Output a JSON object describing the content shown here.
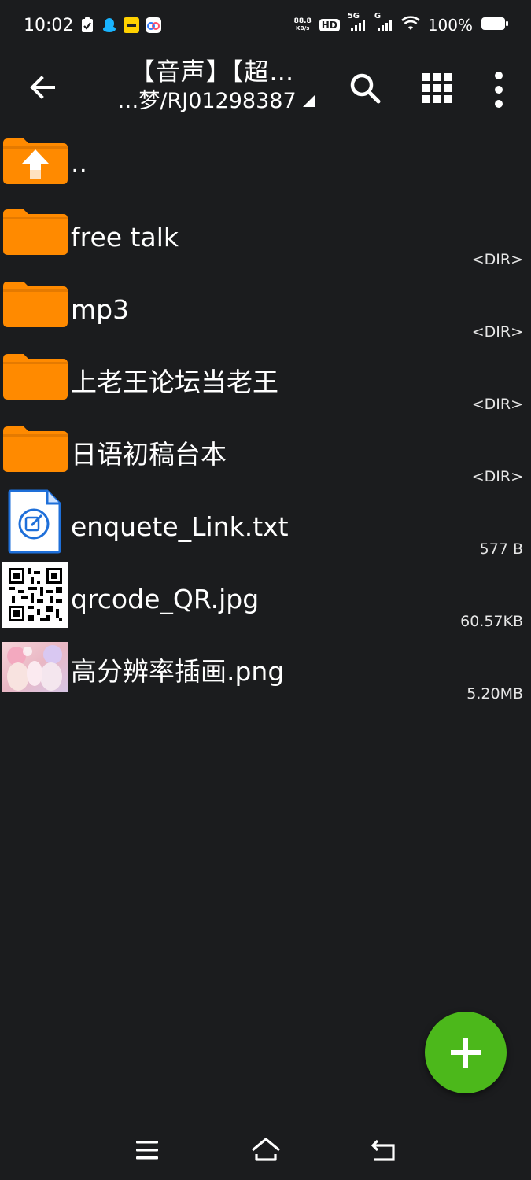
{
  "status_bar": {
    "time": "10:02",
    "net_speed_value": "88.8",
    "net_speed_unit": "KB/s",
    "hd": "HD",
    "sim1": "5G",
    "sim2": "G",
    "battery": "100%",
    "battery_level": 1.0
  },
  "toolbar": {
    "title": "【音声】【超…",
    "subtitle": "…梦/RJ01298387"
  },
  "files": [
    {
      "name": "..",
      "meta": "",
      "type": "parent"
    },
    {
      "name": "free talk",
      "meta": "<DIR>",
      "type": "folder"
    },
    {
      "name": "mp3",
      "meta": "<DIR>",
      "type": "folder"
    },
    {
      "name": "上老王论坛当老王",
      "meta": "<DIR>",
      "type": "folder"
    },
    {
      "name": "日语初稿台本",
      "meta": "<DIR>",
      "type": "folder"
    },
    {
      "name": "enquete_Link.txt",
      "meta": "577 B",
      "type": "text"
    },
    {
      "name": "qrcode_QR.jpg",
      "meta": "60.57KB",
      "type": "qr"
    },
    {
      "name": "高分辨率插画.png",
      "meta": "5.20MB",
      "type": "image"
    }
  ],
  "colors": {
    "background": "#1b1c1e",
    "folder": "#ff8a00",
    "fab": "#4cb81b"
  }
}
